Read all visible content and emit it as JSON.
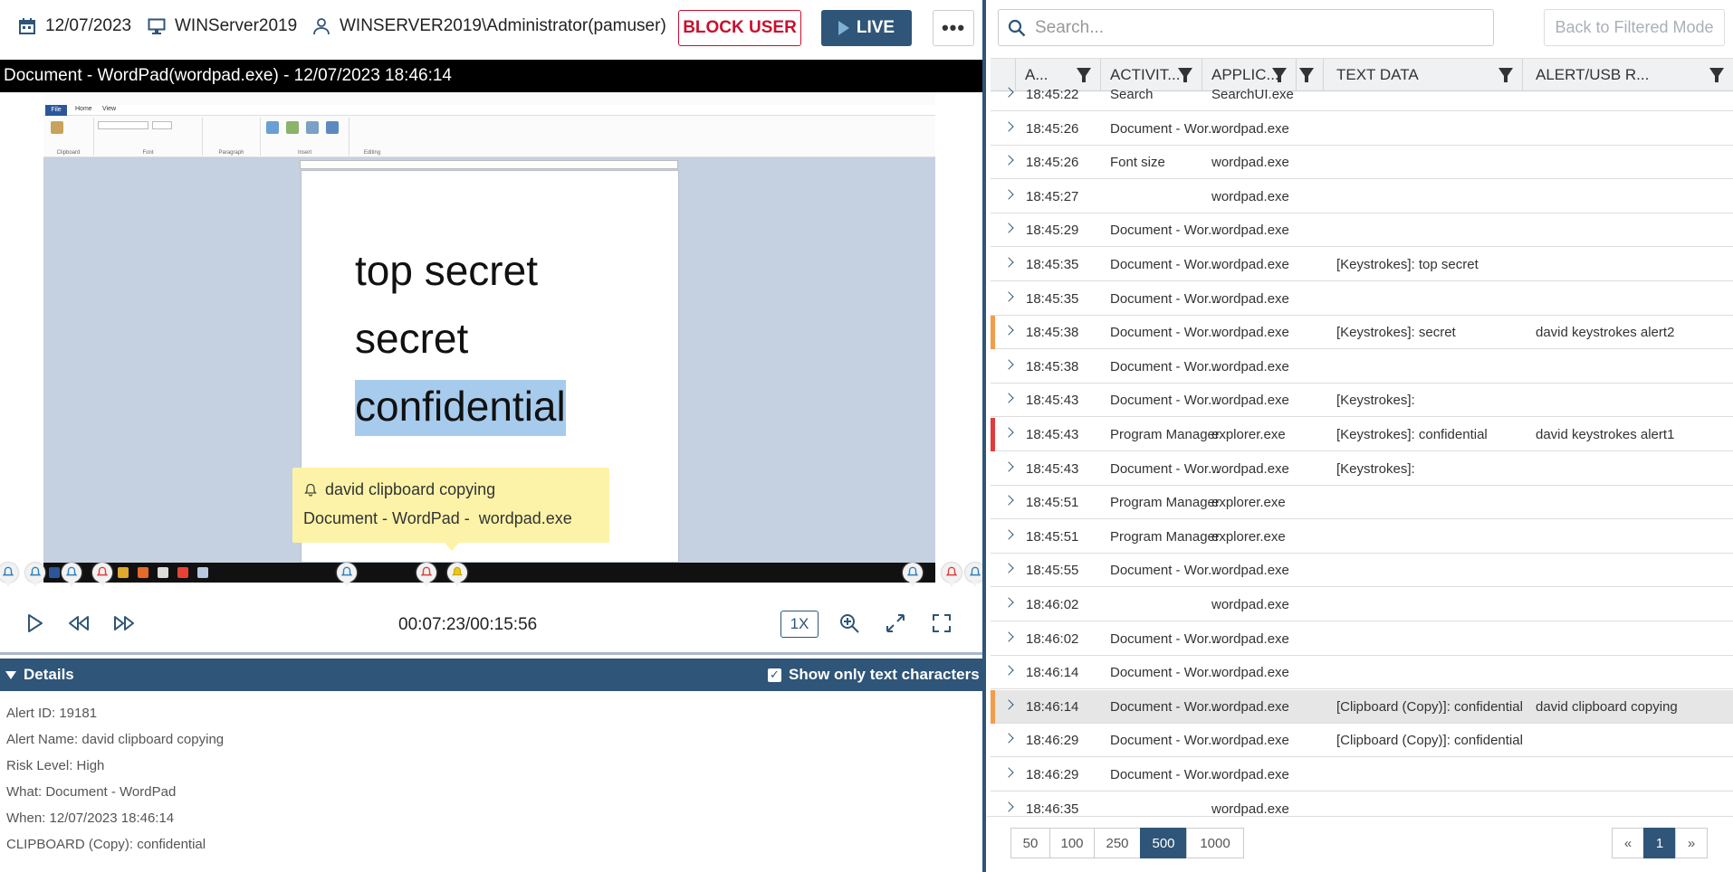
{
  "topbar": {
    "date": "12/07/2023",
    "computer": "WINServer2019",
    "user": "WINSERVER2019\\Administrator(pamuser)",
    "block_user_label": "BLOCK USER",
    "live_label": "LIVE",
    "more_label": "•••"
  },
  "video": {
    "title": "Document - WordPad(wordpad.exe) - 12/07/2023 18:46:14",
    "doc_lines": [
      "top secret",
      "secret",
      "confidential"
    ],
    "tooltip": {
      "alert": "david clipboard copying",
      "detail": "Document - WordPad -  wordpad.exe"
    },
    "progress_fraction": 0.462
  },
  "controls": {
    "time": "00:07:23/00:15:56",
    "speed": "1X"
  },
  "details": {
    "header": "Details",
    "show_only_text": "Show only text characters",
    "show_only_text_checked": true,
    "lines": [
      "Alert ID: 19181",
      "Alert Name: david clipboard copying",
      "Risk Level: High",
      "What: Document - WordPad",
      "When: 12/07/2023 18:46:14",
      "CLIPBOARD (Copy): confidential"
    ]
  },
  "right": {
    "search_placeholder": "Search...",
    "back_label": "Back to Filtered Mode",
    "columns": [
      "A...",
      "ACTIVIT...",
      "APPLIC...",
      "",
      "TEXT DATA",
      "ALERT/USB R..."
    ],
    "rows": [
      {
        "time": "18:45:22",
        "activity": "Search",
        "app": "SearchUI.exe",
        "text": "",
        "alert": "",
        "flag": ""
      },
      {
        "time": "18:45:26",
        "activity": "Document - Wor...",
        "app": "wordpad.exe",
        "text": "",
        "alert": "",
        "flag": ""
      },
      {
        "time": "18:45:26",
        "activity": "Font size",
        "app": "wordpad.exe",
        "text": "",
        "alert": "",
        "flag": ""
      },
      {
        "time": "18:45:27",
        "activity": "",
        "app": "wordpad.exe",
        "text": "",
        "alert": "",
        "flag": ""
      },
      {
        "time": "18:45:29",
        "activity": "Document - Wor...",
        "app": "wordpad.exe",
        "text": "",
        "alert": "",
        "flag": ""
      },
      {
        "time": "18:45:35",
        "activity": "Document - Wor...",
        "app": "wordpad.exe",
        "text": "[Keystrokes]: top secret",
        "alert": "",
        "flag": ""
      },
      {
        "time": "18:45:35",
        "activity": "Document - Wor...",
        "app": "wordpad.exe",
        "text": "",
        "alert": "",
        "flag": ""
      },
      {
        "time": "18:45:38",
        "activity": "Document - Wor...",
        "app": "wordpad.exe",
        "text": "[Keystrokes]: secret",
        "alert": "david keystrokes alert2",
        "flag": "#f29d49"
      },
      {
        "time": "18:45:38",
        "activity": "Document - Wor...",
        "app": "wordpad.exe",
        "text": "",
        "alert": "",
        "flag": ""
      },
      {
        "time": "18:45:43",
        "activity": "Document - Wor...",
        "app": "wordpad.exe",
        "text": "[Keystrokes]:",
        "alert": "",
        "flag": ""
      },
      {
        "time": "18:45:43",
        "activity": "Program Manager",
        "app": "explorer.exe",
        "text": "[Keystrokes]: confidential",
        "alert": "david keystrokes alert1",
        "flag": "#e03c3c"
      },
      {
        "time": "18:45:43",
        "activity": "Document - Wor...",
        "app": "wordpad.exe",
        "text": "[Keystrokes]:",
        "alert": "",
        "flag": ""
      },
      {
        "time": "18:45:51",
        "activity": "Program Manager",
        "app": "explorer.exe",
        "text": "",
        "alert": "",
        "flag": ""
      },
      {
        "time": "18:45:51",
        "activity": "Program Manager",
        "app": "explorer.exe",
        "text": "",
        "alert": "",
        "flag": ""
      },
      {
        "time": "18:45:55",
        "activity": "Document - Wor...",
        "app": "wordpad.exe",
        "text": "",
        "alert": "",
        "flag": ""
      },
      {
        "time": "18:46:02",
        "activity": "",
        "app": "wordpad.exe",
        "text": "",
        "alert": "",
        "flag": ""
      },
      {
        "time": "18:46:02",
        "activity": "Document - Wor...",
        "app": "wordpad.exe",
        "text": "",
        "alert": "",
        "flag": ""
      },
      {
        "time": "18:46:14",
        "activity": "Document - Wor...",
        "app": "wordpad.exe",
        "text": "",
        "alert": "",
        "flag": ""
      },
      {
        "time": "18:46:14",
        "activity": "Document - Wor...",
        "app": "wordpad.exe",
        "text": "[Clipboard (Copy)]: confidential",
        "alert": "david clipboard copying",
        "flag": "#f29d49",
        "selected": true
      },
      {
        "time": "18:46:29",
        "activity": "Document - Wor...",
        "app": "wordpad.exe",
        "text": "[Clipboard (Copy)]: confidential",
        "alert": "",
        "flag": ""
      },
      {
        "time": "18:46:29",
        "activity": "Document - Wor...",
        "app": "wordpad.exe",
        "text": "",
        "alert": "",
        "flag": ""
      },
      {
        "time": "18:46:35",
        "activity": "",
        "app": "wordpad.exe",
        "text": "",
        "alert": "",
        "flag": ""
      }
    ],
    "page_sizes": [
      "50",
      "100",
      "250",
      "500",
      "1000"
    ],
    "active_page_size": "500",
    "pagination": {
      "prev": "«",
      "current": "1",
      "next": "»"
    }
  },
  "colors": {
    "accent": "#2f5578",
    "danger": "#c8102e",
    "alert_orange": "#f29d49",
    "alert_red": "#e03c3c"
  }
}
